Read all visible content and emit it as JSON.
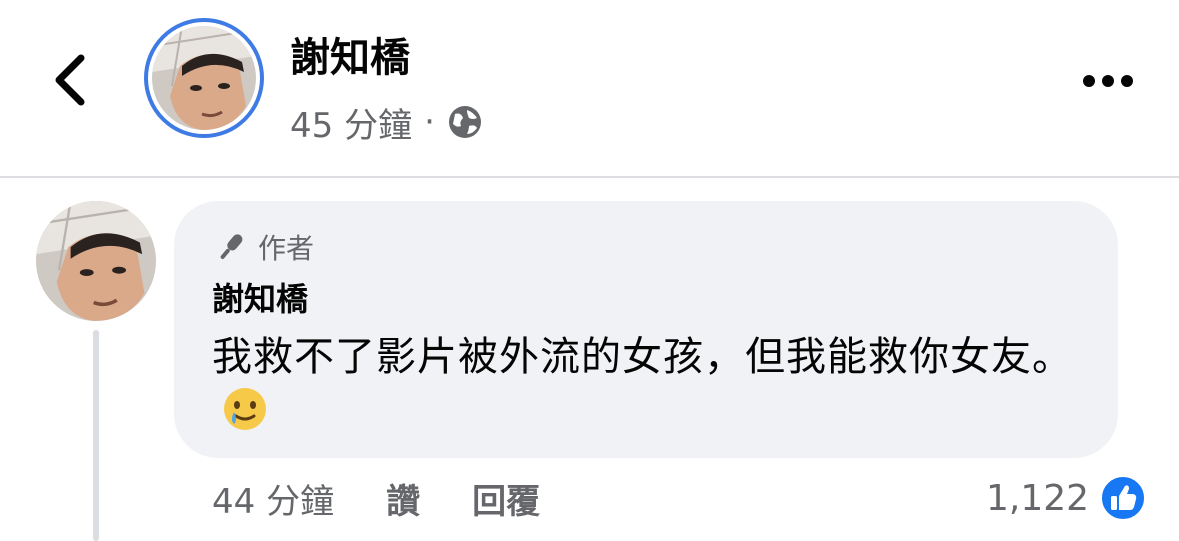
{
  "header": {
    "back_icon": "chevron-left-icon",
    "poster_name": "謝知橋",
    "time": "45 分鐘",
    "separator": "·",
    "privacy_icon": "globe-icon",
    "more_icon": "ellipsis-icon"
  },
  "comment": {
    "author_badge": "作者",
    "author_badge_icon": "microphone-icon",
    "name": "謝知橋",
    "text": "我救不了影片被外流的女孩，但我能救你女友。",
    "emoji_icon": "smiling-face-with-tear-icon",
    "time": "44 分鐘",
    "like_label": "讚",
    "reply_label": "回覆",
    "reaction_count": "1,122",
    "reaction_icon": "like-thumb-icon"
  },
  "colors": {
    "accent": "#3f7be4",
    "secondary_text": "#65676b",
    "bubble_bg": "#f0f2f5",
    "like_blue": "#1877f2"
  }
}
